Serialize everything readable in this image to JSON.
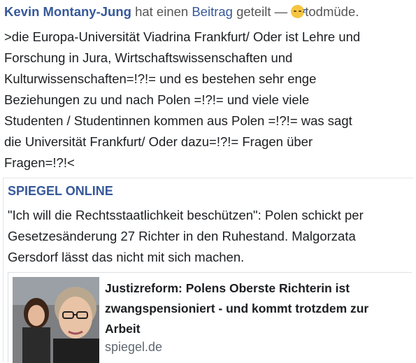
{
  "post": {
    "author": "Kevin Montany-Jung",
    "action_text": "hat einen",
    "object_link": "Beitrag",
    "action_suffix": "geteilt —",
    "feeling_icon": "sleepy-face-emoji",
    "feeling": "todmüde.",
    "body": ">die Europa-Universität Viadrina Frankfurt/ Oder ist Lehre und\nForschung in Jura, Wirtschaftswissenschaften und\nKulturwissenschaften=!?!= und es bestehen sehr enge\nBeziehungen zu und nach Polen =!?!= und viele viele\nStudenten / Studentinnen kommen aus Polen =!?!= was sagt\ndie Universität Frankfurt/ Oder dazu=!?!= Fragen über\nFragen=!?!<"
  },
  "shared": {
    "source": "SPIEGEL ONLINE",
    "description": "\"Ich will die Rechtsstaatlichkeit beschützen\": Polen schickt per\nGesetzesänderung 27 Richter in den Ruhestand. Malgorzata\nGersdorf lässt das nicht mit sich machen.",
    "link_title": "Justizreform: Polens Oberste Richterin ist zwangspensioniert - und kommt trotzdem zur Arbeit",
    "link_domain": "spiegel.de"
  },
  "colors": {
    "link_blue": "#365899",
    "text": "#1c1e21",
    "muted": "#606770"
  }
}
